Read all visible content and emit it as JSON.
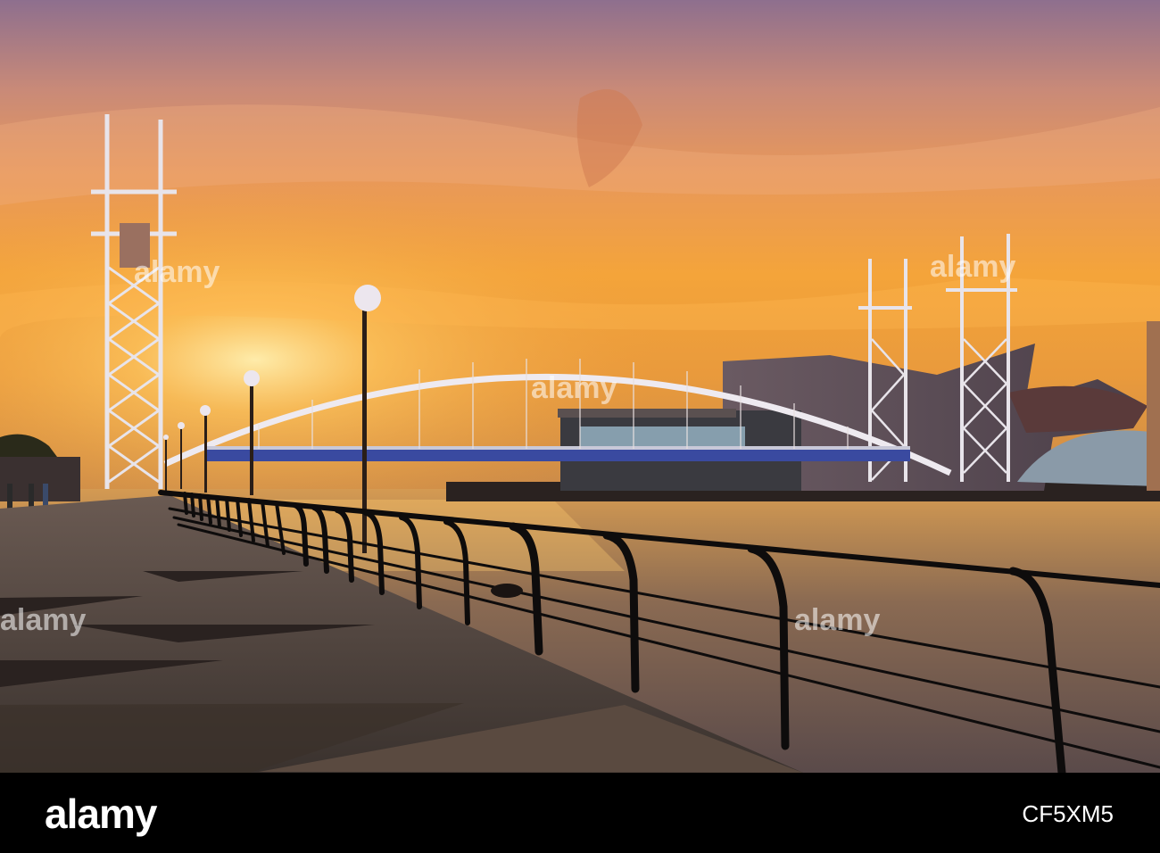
{
  "watermark": {
    "text": "alamy"
  },
  "footer": {
    "logo": "alamy",
    "image_id": "CF5XM5"
  },
  "colors": {
    "footer_background": "#000000",
    "footer_text": "#ffffff",
    "sky_top": "#8a6a8a",
    "sky_glow": "#f5a030",
    "water": "#7a5a3a",
    "silhouette": "#1a1410"
  }
}
